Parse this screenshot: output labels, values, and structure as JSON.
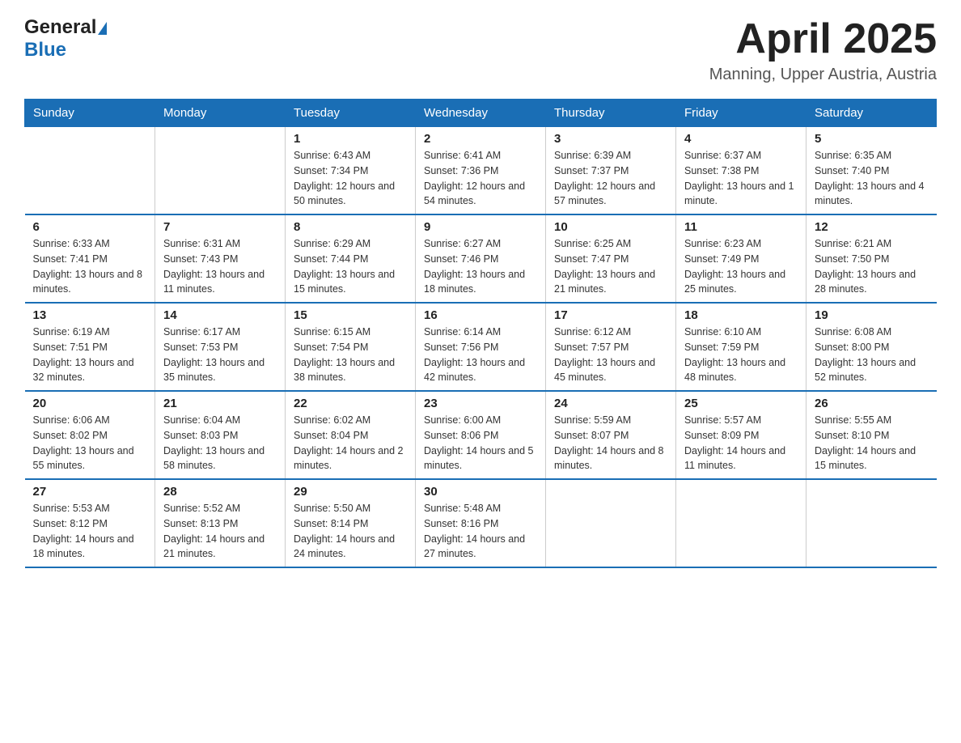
{
  "header": {
    "logo_general": "General",
    "logo_blue": "Blue",
    "title": "April 2025",
    "subtitle": "Manning, Upper Austria, Austria"
  },
  "days_of_week": [
    "Sunday",
    "Monday",
    "Tuesday",
    "Wednesday",
    "Thursday",
    "Friday",
    "Saturday"
  ],
  "weeks": [
    [
      {
        "day": "",
        "sunrise": "",
        "sunset": "",
        "daylight": ""
      },
      {
        "day": "",
        "sunrise": "",
        "sunset": "",
        "daylight": ""
      },
      {
        "day": "1",
        "sunrise": "Sunrise: 6:43 AM",
        "sunset": "Sunset: 7:34 PM",
        "daylight": "Daylight: 12 hours and 50 minutes."
      },
      {
        "day": "2",
        "sunrise": "Sunrise: 6:41 AM",
        "sunset": "Sunset: 7:36 PM",
        "daylight": "Daylight: 12 hours and 54 minutes."
      },
      {
        "day": "3",
        "sunrise": "Sunrise: 6:39 AM",
        "sunset": "Sunset: 7:37 PM",
        "daylight": "Daylight: 12 hours and 57 minutes."
      },
      {
        "day": "4",
        "sunrise": "Sunrise: 6:37 AM",
        "sunset": "Sunset: 7:38 PM",
        "daylight": "Daylight: 13 hours and 1 minute."
      },
      {
        "day": "5",
        "sunrise": "Sunrise: 6:35 AM",
        "sunset": "Sunset: 7:40 PM",
        "daylight": "Daylight: 13 hours and 4 minutes."
      }
    ],
    [
      {
        "day": "6",
        "sunrise": "Sunrise: 6:33 AM",
        "sunset": "Sunset: 7:41 PM",
        "daylight": "Daylight: 13 hours and 8 minutes."
      },
      {
        "day": "7",
        "sunrise": "Sunrise: 6:31 AM",
        "sunset": "Sunset: 7:43 PM",
        "daylight": "Daylight: 13 hours and 11 minutes."
      },
      {
        "day": "8",
        "sunrise": "Sunrise: 6:29 AM",
        "sunset": "Sunset: 7:44 PM",
        "daylight": "Daylight: 13 hours and 15 minutes."
      },
      {
        "day": "9",
        "sunrise": "Sunrise: 6:27 AM",
        "sunset": "Sunset: 7:46 PM",
        "daylight": "Daylight: 13 hours and 18 minutes."
      },
      {
        "day": "10",
        "sunrise": "Sunrise: 6:25 AM",
        "sunset": "Sunset: 7:47 PM",
        "daylight": "Daylight: 13 hours and 21 minutes."
      },
      {
        "day": "11",
        "sunrise": "Sunrise: 6:23 AM",
        "sunset": "Sunset: 7:49 PM",
        "daylight": "Daylight: 13 hours and 25 minutes."
      },
      {
        "day": "12",
        "sunrise": "Sunrise: 6:21 AM",
        "sunset": "Sunset: 7:50 PM",
        "daylight": "Daylight: 13 hours and 28 minutes."
      }
    ],
    [
      {
        "day": "13",
        "sunrise": "Sunrise: 6:19 AM",
        "sunset": "Sunset: 7:51 PM",
        "daylight": "Daylight: 13 hours and 32 minutes."
      },
      {
        "day": "14",
        "sunrise": "Sunrise: 6:17 AM",
        "sunset": "Sunset: 7:53 PM",
        "daylight": "Daylight: 13 hours and 35 minutes."
      },
      {
        "day": "15",
        "sunrise": "Sunrise: 6:15 AM",
        "sunset": "Sunset: 7:54 PM",
        "daylight": "Daylight: 13 hours and 38 minutes."
      },
      {
        "day": "16",
        "sunrise": "Sunrise: 6:14 AM",
        "sunset": "Sunset: 7:56 PM",
        "daylight": "Daylight: 13 hours and 42 minutes."
      },
      {
        "day": "17",
        "sunrise": "Sunrise: 6:12 AM",
        "sunset": "Sunset: 7:57 PM",
        "daylight": "Daylight: 13 hours and 45 minutes."
      },
      {
        "day": "18",
        "sunrise": "Sunrise: 6:10 AM",
        "sunset": "Sunset: 7:59 PM",
        "daylight": "Daylight: 13 hours and 48 minutes."
      },
      {
        "day": "19",
        "sunrise": "Sunrise: 6:08 AM",
        "sunset": "Sunset: 8:00 PM",
        "daylight": "Daylight: 13 hours and 52 minutes."
      }
    ],
    [
      {
        "day": "20",
        "sunrise": "Sunrise: 6:06 AM",
        "sunset": "Sunset: 8:02 PM",
        "daylight": "Daylight: 13 hours and 55 minutes."
      },
      {
        "day": "21",
        "sunrise": "Sunrise: 6:04 AM",
        "sunset": "Sunset: 8:03 PM",
        "daylight": "Daylight: 13 hours and 58 minutes."
      },
      {
        "day": "22",
        "sunrise": "Sunrise: 6:02 AM",
        "sunset": "Sunset: 8:04 PM",
        "daylight": "Daylight: 14 hours and 2 minutes."
      },
      {
        "day": "23",
        "sunrise": "Sunrise: 6:00 AM",
        "sunset": "Sunset: 8:06 PM",
        "daylight": "Daylight: 14 hours and 5 minutes."
      },
      {
        "day": "24",
        "sunrise": "Sunrise: 5:59 AM",
        "sunset": "Sunset: 8:07 PM",
        "daylight": "Daylight: 14 hours and 8 minutes."
      },
      {
        "day": "25",
        "sunrise": "Sunrise: 5:57 AM",
        "sunset": "Sunset: 8:09 PM",
        "daylight": "Daylight: 14 hours and 11 minutes."
      },
      {
        "day": "26",
        "sunrise": "Sunrise: 5:55 AM",
        "sunset": "Sunset: 8:10 PM",
        "daylight": "Daylight: 14 hours and 15 minutes."
      }
    ],
    [
      {
        "day": "27",
        "sunrise": "Sunrise: 5:53 AM",
        "sunset": "Sunset: 8:12 PM",
        "daylight": "Daylight: 14 hours and 18 minutes."
      },
      {
        "day": "28",
        "sunrise": "Sunrise: 5:52 AM",
        "sunset": "Sunset: 8:13 PM",
        "daylight": "Daylight: 14 hours and 21 minutes."
      },
      {
        "day": "29",
        "sunrise": "Sunrise: 5:50 AM",
        "sunset": "Sunset: 8:14 PM",
        "daylight": "Daylight: 14 hours and 24 minutes."
      },
      {
        "day": "30",
        "sunrise": "Sunrise: 5:48 AM",
        "sunset": "Sunset: 8:16 PM",
        "daylight": "Daylight: 14 hours and 27 minutes."
      },
      {
        "day": "",
        "sunrise": "",
        "sunset": "",
        "daylight": ""
      },
      {
        "day": "",
        "sunrise": "",
        "sunset": "",
        "daylight": ""
      },
      {
        "day": "",
        "sunrise": "",
        "sunset": "",
        "daylight": ""
      }
    ]
  ]
}
